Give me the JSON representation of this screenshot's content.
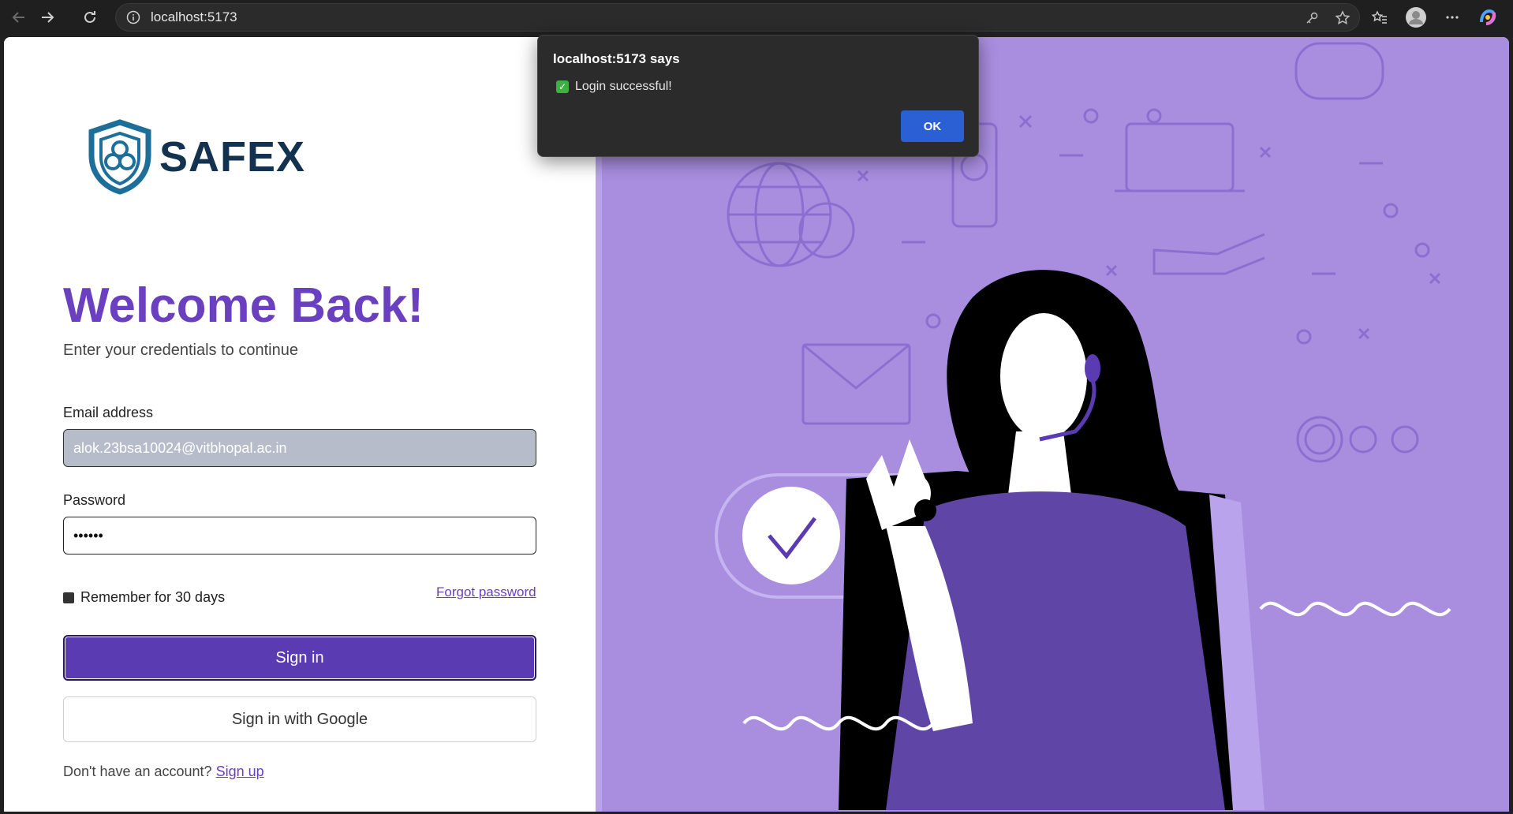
{
  "browser": {
    "url": "localhost:5173"
  },
  "logo": {
    "text": "SAFEX"
  },
  "login": {
    "heading": "Welcome Back!",
    "subtitle": "Enter your credentials to continue",
    "email_label": "Email address",
    "email_value": "alok.23bsa10024@vitbhopal.ac.in",
    "password_label": "Password",
    "password_value": "••••••",
    "remember_label": "Remember for 30 days",
    "forgot_label": "Forgot password",
    "signin_label": "Sign in",
    "google_label": "Sign in with Google",
    "no_account_text": "Don't have an account?",
    "signup_label": "Sign up"
  },
  "dialog": {
    "title": "localhost:5173 says",
    "message": "Login successful!",
    "ok_label": "OK"
  },
  "colors": {
    "brand": "#6a3fc0",
    "primary_button": "#5b3bb2",
    "illustration_bg": "#a98ee0"
  }
}
